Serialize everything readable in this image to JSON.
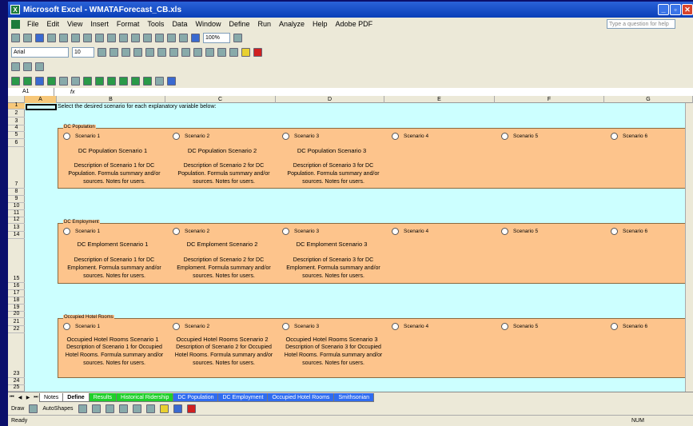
{
  "window": {
    "title": "Microsoft Excel - WMATAForecast_CB.xls",
    "app_icon": "excel-icon"
  },
  "menu": [
    "File",
    "Edit",
    "View",
    "Insert",
    "Format",
    "Tools",
    "Data",
    "Window",
    "Define",
    "Run",
    "Analyze",
    "Help",
    "Adobe PDF"
  ],
  "help_box": {
    "placeholder": "Type a question for help"
  },
  "toolbar": {
    "zoom": "100%",
    "font": "Arial",
    "font_size": "10"
  },
  "formula_bar": {
    "name_box": "A1",
    "fx": "fx",
    "value": ""
  },
  "columns": [
    "A",
    "B",
    "C",
    "D",
    "E",
    "F",
    "G"
  ],
  "rows": [
    "1",
    "2",
    "3",
    "4",
    "5",
    "6",
    "7",
    "8",
    "9",
    "10",
    "11",
    "12",
    "13",
    "14",
    "15",
    "16",
    "17",
    "18",
    "19",
    "20",
    "21",
    "22",
    "23",
    "24",
    "25"
  ],
  "instruction": "Select the desired scenario for each explanatory variable below:",
  "groups": [
    {
      "title": "DC Population",
      "options": [
        "Scenario 1",
        "Scenario 2",
        "Scenario 3",
        "Scenario 4",
        "Scenario 5",
        "Scenario 6"
      ],
      "scenario_names": [
        "DC Population Scenario 1",
        "DC Population Scenario 2",
        "DC Population Scenario 3"
      ],
      "descriptions": [
        "Description of Scenario 1 for DC Population.  Formula summary and/or sources. Notes for users.",
        "Description of Scenario 2 for DC Population.  Formula summary and/or sources. Notes for users.",
        "Description of Scenario 3 for DC Population.  Formula summary and/or sources. Notes for users."
      ]
    },
    {
      "title": "DC Employment",
      "options": [
        "Scenario 1",
        "Scenario 2",
        "Scenario 3",
        "Scenario 4",
        "Scenario 5",
        "Scenario 6"
      ],
      "scenario_names": [
        "DC Emploment Scenario 1",
        "DC Emploment Scenario 2",
        "DC Emploment Scenario 3"
      ],
      "descriptions": [
        "Description of Scenario 1 for DC Emploment.  Formula summary and/or sources. Notes for users.",
        "Description of Scenario 2 for DC Emploment.  Formula summary and/or sources. Notes for users.",
        "Description of Scenario 3 for DC Emploment.  Formula summary and/or sources. Notes for users."
      ]
    },
    {
      "title": "Occupied Hotel Rooms",
      "options": [
        "Scenario 1",
        "Scenario 2",
        "Scenario 3",
        "Scenario 4",
        "Scenario 5",
        "Scenario 6"
      ],
      "scenario_names": [
        "Occupied Hotel Rooms Scenario 1",
        "Occupied Hotel Rooms Scenario 2",
        "Occupied Hotel Rooms Scenario 3"
      ],
      "descriptions": [
        "Description of Scenario 1 for Occupied Hotel Rooms.  Formula summary and/or sources. Notes for users.",
        "Description of Scenario 2 for Occupied Hotel Rooms.  Formula summary and/or sources. Notes for users.",
        "Description of Scenario 3 for Occupied Hotel Rooms.  Formula summary and/or sources. Notes for users."
      ]
    }
  ],
  "tabs": [
    {
      "label": "Notes",
      "style": "plain"
    },
    {
      "label": "Define",
      "style": "active"
    },
    {
      "label": "Results",
      "style": "green"
    },
    {
      "label": "Historical Ridership",
      "style": "green"
    },
    {
      "label": "DC Population",
      "style": "blue"
    },
    {
      "label": "DC Employment",
      "style": "blue"
    },
    {
      "label": "Occupied Hotel Rooms",
      "style": "blue"
    },
    {
      "label": "Smithsonian",
      "style": "blue"
    }
  ],
  "draw_toolbar": {
    "draw": "Draw",
    "autoshapes": "AutoShapes"
  },
  "status": {
    "left": "Ready",
    "num": "NUM"
  },
  "colors": {
    "sheet_bg": "#ccffff",
    "group_bg": "#fdc48c",
    "title_bar": "#0a3fb8"
  }
}
